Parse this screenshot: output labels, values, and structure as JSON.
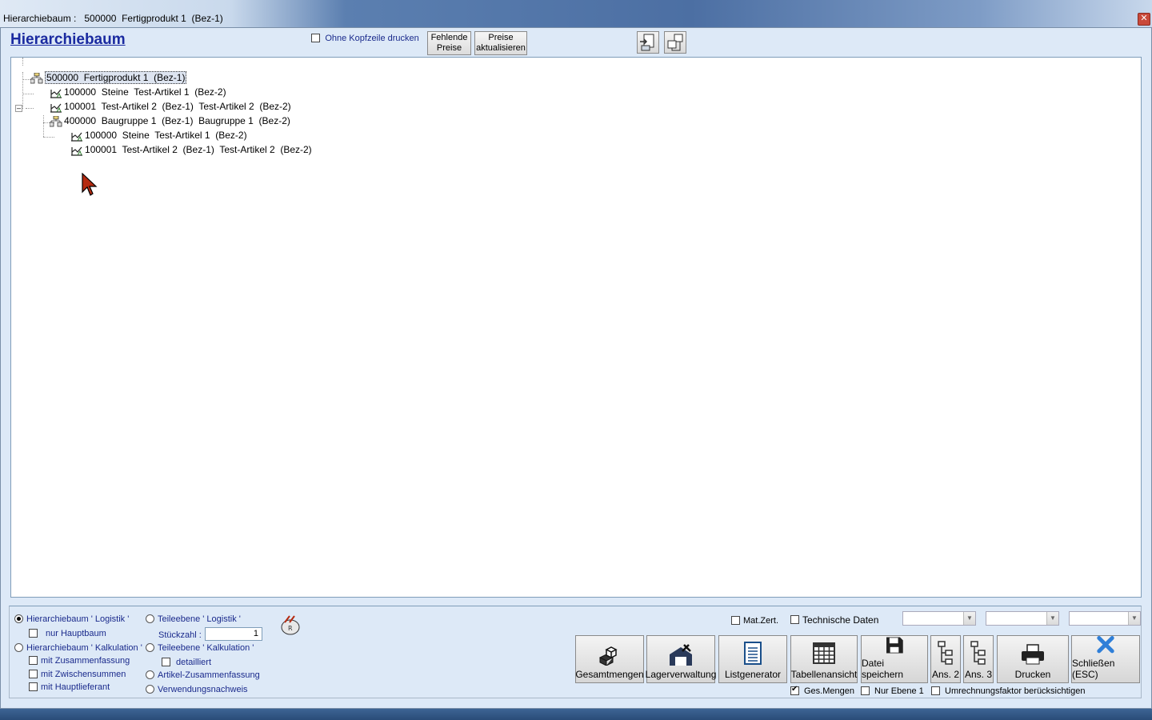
{
  "window": {
    "title": "Hierarchiebaum :   500000  Fertigprodukt 1  (Bez-1)",
    "close_glyph": "✕"
  },
  "toolbar": {
    "heading": "Hierarchiebaum",
    "no_header_print_label": "Ohne Kopfzeile drucken",
    "no_header_print_checked": false,
    "missing_prices_line1": "Fehlende",
    "missing_prices_line2": "Preise",
    "update_prices_line1": "Preise",
    "update_prices_line2": "aktualisieren",
    "icon1": "export-document-icon",
    "icon2": "expand-tree-icon"
  },
  "tree": {
    "nodes": [
      {
        "text": "500000  Fertigprodukt 1  (Bez-1)",
        "icon": "assembly-icon",
        "level": 0,
        "selected": true
      },
      {
        "text": "100000  Steine  Test-Artikel 1  (Bez-2)",
        "icon": "article-icon",
        "level": 1
      },
      {
        "text": "100001  Test-Artikel 2  (Bez-1)  Test-Artikel 2  (Bez-2)",
        "icon": "article-icon",
        "level": 1
      },
      {
        "text": "400000  Baugruppe 1  (Bez-1)  Baugruppe 1  (Bez-2)",
        "icon": "assembly-icon",
        "level": 1,
        "expanded": true
      },
      {
        "text": "100000  Steine  Test-Artikel 1  (Bez-2)",
        "icon": "article-icon",
        "level": 2
      },
      {
        "text": "100001  Test-Artikel 2  (Bez-1)  Test-Artikel 2  (Bez-2)",
        "icon": "article-icon",
        "level": 2
      }
    ],
    "collapse_glyph": "–"
  },
  "options": {
    "hier_logistik": "Hierarchiebaum ' Logistik '",
    "nur_hauptbaum": "nur Hauptbaum",
    "hier_kalkulation": "Hierarchiebaum ' Kalkulation '",
    "mit_zusammenfassung": "mit Zusammenfassung",
    "mit_zwischensummen": "mit Zwischensummen",
    "mit_hauptlieferant": "mit Hauptlieferant",
    "teil_logistik": "Teileebene ' Logistik '",
    "stueckzahl_label": "Stückzahl :",
    "stueckzahl_value": "1",
    "teil_kalkulation": "Teileebene ' Kalkulation '",
    "detailliert": "detailliert",
    "artikel_zusammenfassung": "Artikel-Zusammenfassung",
    "verwendungsnachweis": "Verwendungsnachweis",
    "selected_radio": "hier_logistik"
  },
  "right_options": {
    "mat_zert": "Mat.Zert.",
    "technische_daten": "Technische Daten",
    "ges_mengen": "Ges.Mengen",
    "ges_mengen_checked": true,
    "nur_ebene1": "Nur Ebene 1",
    "umrechnung": "Umrechnungsfaktor berücksichtigen"
  },
  "buttons": {
    "gesamtmengen": "Gesamtmengen",
    "lagerverwaltung": "Lagerverwaltung",
    "listgenerator": "Listgenerator",
    "tabellenansicht": "Tabellenansicht",
    "datei_speichern": "Datei speichern",
    "ans2": "Ans. 2",
    "ans3": "Ans. 3",
    "drucken": "Drucken",
    "schliessen": "Schließen (ESC)"
  },
  "colors": {
    "heading": "#1a2aa0",
    "panel": "#dde9f7",
    "close_x": "#2f7fd8"
  }
}
